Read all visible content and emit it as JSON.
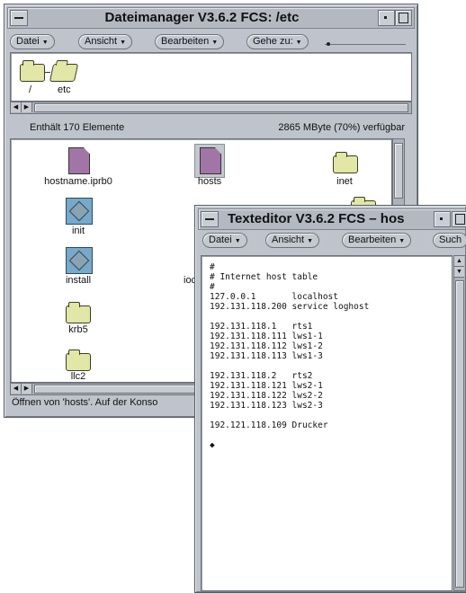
{
  "file_manager": {
    "title": "Dateimanager V3.6.2 FCS: /etc",
    "menus": [
      "Datei",
      "Ansicht",
      "Bearbeiten",
      "Gehe zu:"
    ],
    "path": [
      {
        "label": "/",
        "icon": "folder-icon"
      },
      {
        "label": "etc",
        "icon": "open-folder-icon"
      }
    ],
    "info_left": "Enthält 170 Elemente",
    "info_right": "2865 MByte (70%) verfügbar",
    "items": [
      {
        "label": "hostname.iprb0",
        "icon": "document-icon"
      },
      {
        "label": "hosts",
        "icon": "document-icon",
        "selected": true
      },
      {
        "label": "inet",
        "icon": "folder-icon"
      },
      {
        "label": "init",
        "icon": "executable-icon"
      },
      {
        "label": "install",
        "icon": "executable-icon"
      },
      {
        "label": "ioc",
        "icon": "folder-icon"
      },
      {
        "label": "krb5",
        "icon": "folder-icon"
      },
      {
        "label": "llc2",
        "icon": "folder-icon"
      }
    ],
    "status": "Öffnen von 'hosts'. Auf der Konso"
  },
  "text_editor": {
    "title": "Texteditor V3.6.2 FCS – hos",
    "menus": [
      "Datei",
      "Ansicht",
      "Bearbeiten",
      "Such"
    ],
    "content": "#\n# Internet host table\n#\n127.0.0.1       localhost\n192.131.118.200 service loghost\n\n192.131.118.1   rts1\n192.131.118.111 lws1-1\n192.131.118.112 lws1-2\n192.131.118.113 lws1-3\n\n192.131.118.2   rts2\n192.131.118.121 lws2-1\n192.131.118.122 lws2-2\n192.131.118.123 lws2-3\n\n192.121.118.109 Drucker\n\n◆"
  },
  "colors": {
    "window_bg": "#bfc4cc",
    "folder": "#e2e6a6",
    "document": "#a176a6",
    "executable": "#79a8c8"
  }
}
